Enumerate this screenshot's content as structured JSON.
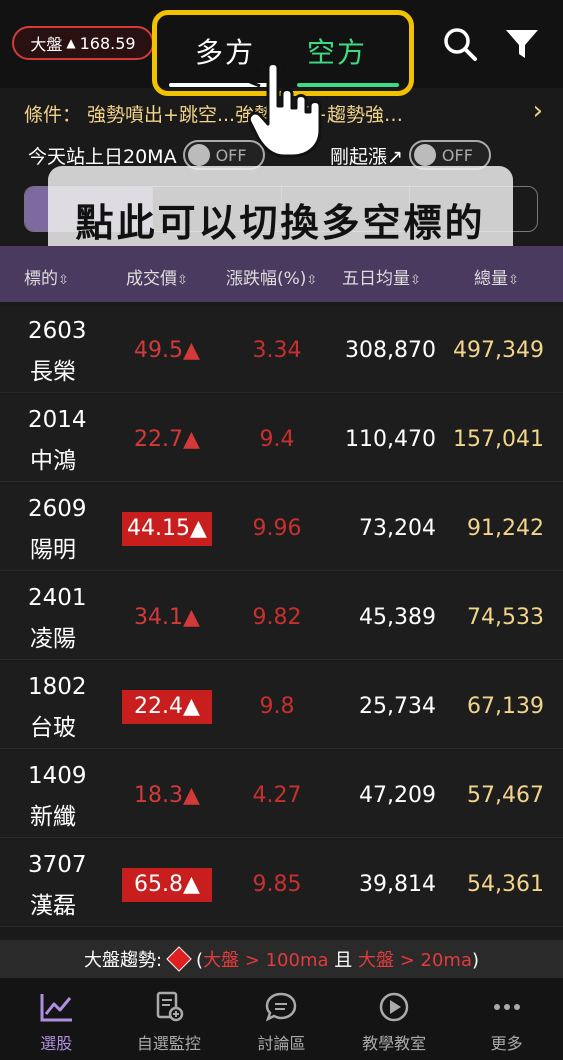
{
  "header": {
    "index_label": "大盤",
    "index_arrow": "▲",
    "index_value": "168.59",
    "tab_long": "多方",
    "tab_short": "空方",
    "search_icon": "search-icon",
    "filter_icon": "filter-icon"
  },
  "conditions": {
    "text": "條件： 強勢噴出+跳空...強勢排行+趨勢強…",
    "chevron": "›"
  },
  "toggles": [
    {
      "label": "今天站上日20MA",
      "state": "OFF"
    },
    {
      "label": "剛起漲↗",
      "state": "OFF"
    }
  ],
  "segments": [
    "",
    "",
    "",
    ""
  ],
  "tooltip": "點此可以切換多空標的",
  "table": {
    "headers": [
      "標的",
      "成交價",
      "漲跌幅(%)",
      "五日均量",
      "總量"
    ],
    "sort_glyph": "⇳",
    "rows": [
      {
        "code": "2603",
        "name": "長榮",
        "price": "49.5▲",
        "boxed": false,
        "chg": "3.34",
        "avg5": "308,870",
        "vol": "497,349"
      },
      {
        "code": "2014",
        "name": "中鴻",
        "price": "22.7▲",
        "boxed": false,
        "chg": "9.4",
        "avg5": "110,470",
        "vol": "157,041"
      },
      {
        "code": "2609",
        "name": "陽明",
        "price": "44.15▲",
        "boxed": true,
        "chg": "9.96",
        "avg5": "73,204",
        "vol": "91,242"
      },
      {
        "code": "2401",
        "name": "凌陽",
        "price": "34.1▲",
        "boxed": false,
        "chg": "9.82",
        "avg5": "45,389",
        "vol": "74,533"
      },
      {
        "code": "1802",
        "name": "台玻",
        "price": "22.4▲",
        "boxed": true,
        "chg": "9.8",
        "avg5": "25,734",
        "vol": "67,139"
      },
      {
        "code": "1409",
        "name": "新纖",
        "price": "18.3▲",
        "boxed": false,
        "chg": "4.27",
        "avg5": "47,209",
        "vol": "57,467"
      },
      {
        "code": "3707",
        "name": "漢磊",
        "price": "65.8▲",
        "boxed": true,
        "chg": "9.85",
        "avg5": "39,814",
        "vol": "54,361"
      }
    ]
  },
  "trend": {
    "label": "大盤趨勢:",
    "open": "(",
    "cond1_red": "大盤",
    "cond1_rest": " > 100ma",
    "and": " 且 ",
    "cond2_red": "大盤",
    "cond2_rest": " > 20ma",
    "close": ")"
  },
  "nav": [
    {
      "label": "選股",
      "icon": "chart-icon",
      "active": true
    },
    {
      "label": "自選監控",
      "icon": "watchlist-icon",
      "active": false
    },
    {
      "label": "討論區",
      "icon": "chat-icon",
      "active": false
    },
    {
      "label": "教學教室",
      "icon": "play-icon",
      "active": false
    },
    {
      "label": "更多",
      "icon": "more-icon",
      "active": false
    }
  ],
  "colors": {
    "accent_purple": "#7e6aa0",
    "highlight_yellow": "#f2c200",
    "short_green": "#3ddc84",
    "up_red": "#d23a3a",
    "volume_gold": "#f2d58a"
  }
}
